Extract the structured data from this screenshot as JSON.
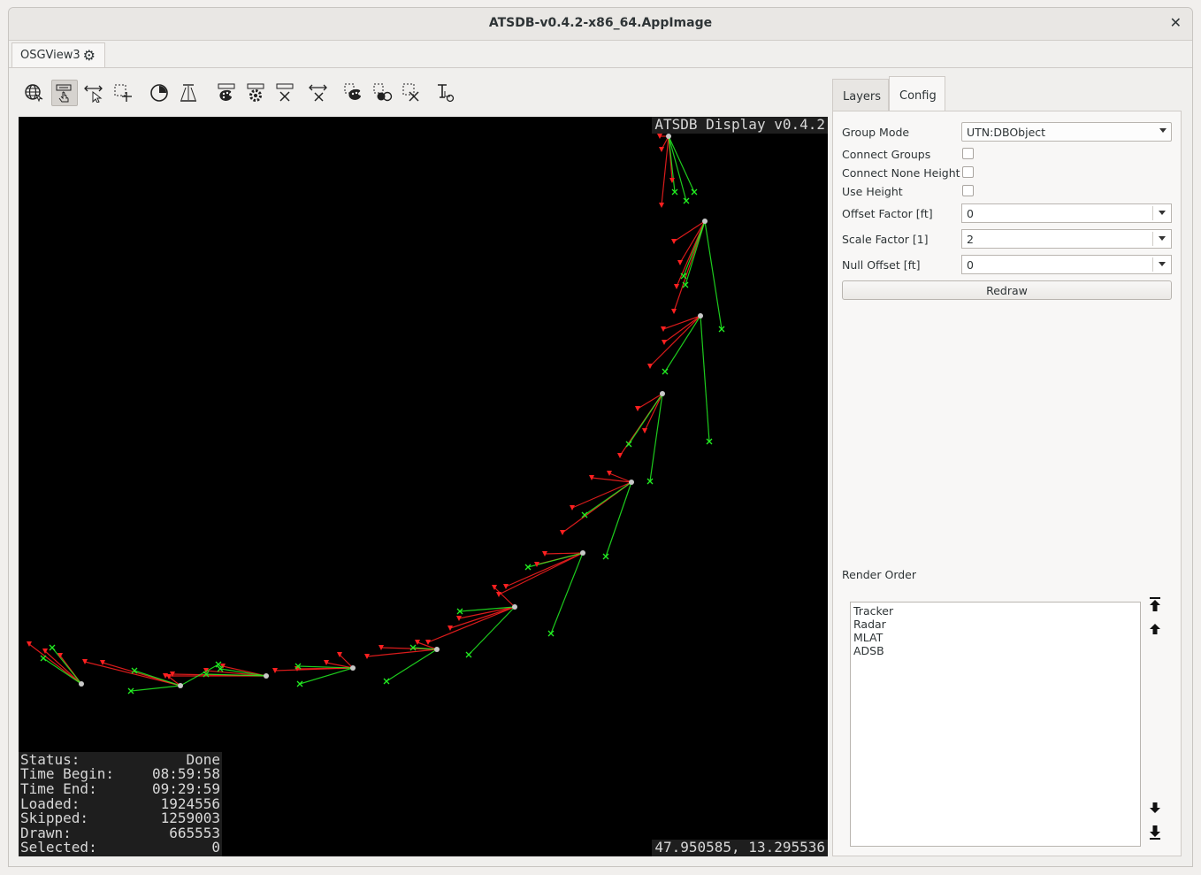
{
  "window": {
    "title": "ATSDB-v0.4.2-x86_64.AppImage",
    "close_glyph": "✕"
  },
  "view_tab": {
    "label": "OSGView3"
  },
  "toolbar": {
    "icons": [
      "globe-icon",
      "navigate-icon",
      "measure-icon",
      "select-add-icon",
      "time-icon",
      "height-icon",
      "style-icon",
      "config-icon",
      "clear-icon",
      "zoom-icon",
      "select-style-icon",
      "select-points-icon",
      "select-clear-icon",
      "label-icon"
    ]
  },
  "view": {
    "title": "ATSDB Display v0.4.2",
    "coords": "47.950585, 13.295536",
    "stats": [
      {
        "label": "Status:",
        "value": "Done"
      },
      {
        "label": "Time Begin:",
        "value": "08:59:58"
      },
      {
        "label": "Time End:",
        "value": "09:29:59"
      },
      {
        "label": "Loaded:",
        "value": "1924556"
      },
      {
        "label": "Skipped:",
        "value": "1259003"
      },
      {
        "label": "Drawn:",
        "value": "665553"
      },
      {
        "label": "Selected:",
        "value": "0"
      }
    ],
    "colors": {
      "tracker": "#c8c8c8",
      "radar": "#ff2020",
      "adsb": "#22ee22"
    }
  },
  "panel": {
    "tabs": [
      "Layers",
      "Config"
    ],
    "active_tab": "Config",
    "group_mode_label": "Group Mode",
    "group_mode_value": "UTN:DBObject",
    "connect_groups_label": "Connect Groups",
    "connect_none_height_label": "Connect None Height",
    "use_height_label": "Use Height",
    "offset_factor_label": "Offset Factor [ft]",
    "offset_factor_value": "0",
    "scale_factor_label": "Scale Factor [1]",
    "scale_factor_value": "2",
    "null_offset_label": "Null Offset [ft]",
    "null_offset_value": "0",
    "redraw_label": "Redraw",
    "render_order_label": "Render Order",
    "render_order": [
      "Tracker",
      "Radar",
      "MLAT",
      "ADSB"
    ]
  }
}
